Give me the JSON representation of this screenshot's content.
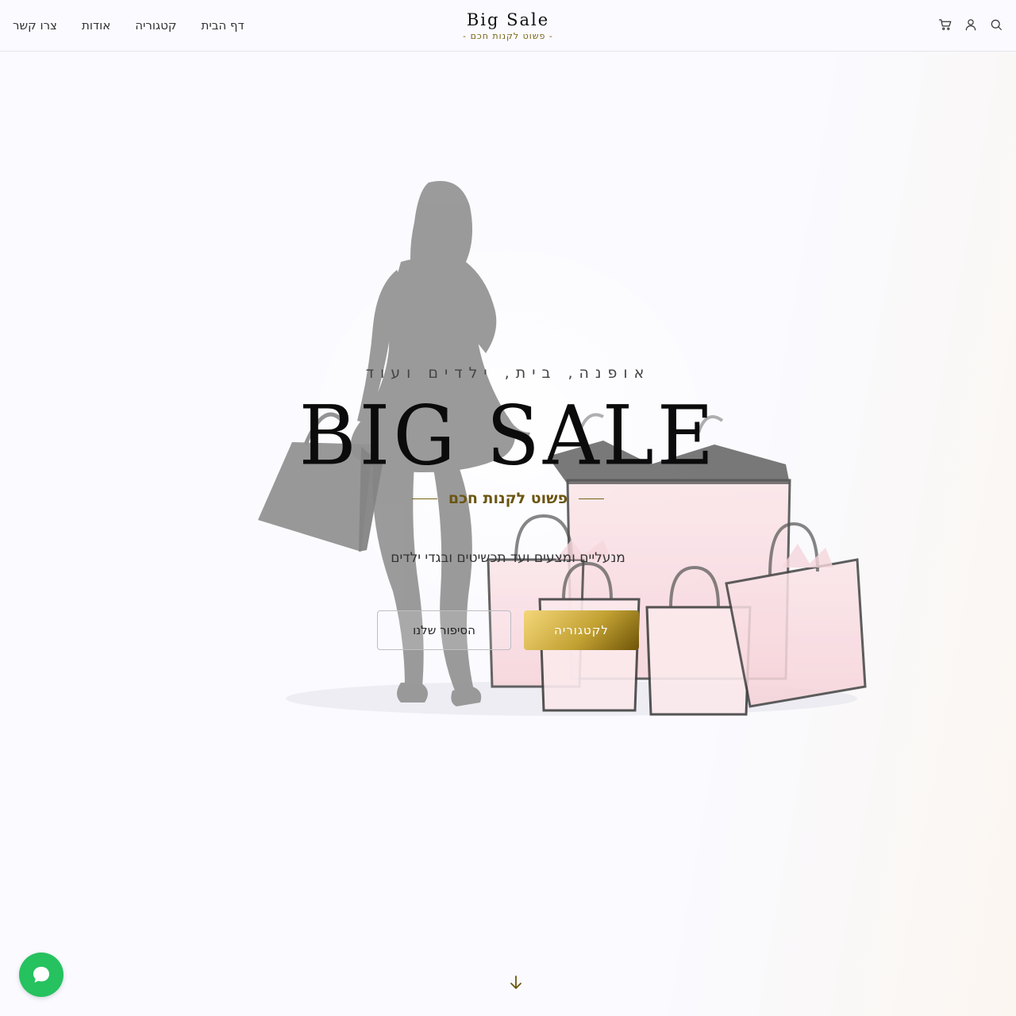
{
  "header": {
    "nav": [
      {
        "id": "contact",
        "label": "צרו קשר"
      },
      {
        "id": "about",
        "label": "אודות"
      },
      {
        "id": "category",
        "label": "קטגוריה"
      },
      {
        "id": "home",
        "label": "דף הבית"
      }
    ],
    "logo_title": "Big Sale",
    "logo_tagline": "- פשוט לקנות חכם -",
    "icons": [
      "cart-icon",
      "user-icon",
      "search-icon"
    ]
  },
  "hero": {
    "eyebrow": "אופנה, בית, ילדים ועוד",
    "title": "BIG SALE",
    "tagline": "פשוט לקנות חכם",
    "lead": "מנעליים ומצעים ועד תכשיטים ובגדי ילדים",
    "secondary_button": "הסיפור שלנו",
    "primary_button": "לקטגוריה"
  },
  "colors": {
    "gold": "#7a6414",
    "gold_light": "#f4d77a",
    "chat_green": "#25c25f",
    "background": "#fafaff"
  }
}
